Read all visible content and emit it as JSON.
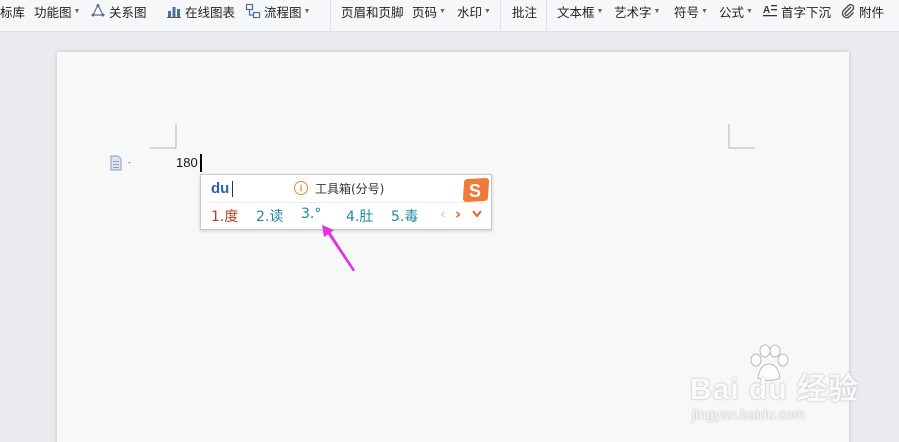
{
  "toolbar": {
    "items": [
      {
        "label": "标库",
        "caret": false,
        "icon": "none"
      },
      {
        "label": "功能图",
        "caret": true,
        "icon": "none"
      },
      {
        "label": "关系图",
        "caret": false,
        "icon": "relation-graph-icon"
      },
      {
        "label": "在线图表",
        "caret": false,
        "icon": "chart-icon"
      },
      {
        "label": "流程图",
        "caret": true,
        "icon": "flowchart-icon"
      },
      {
        "label": "页眉和页脚",
        "caret": false,
        "icon": "none"
      },
      {
        "label": "页码",
        "caret": true,
        "icon": "none"
      },
      {
        "label": "水印",
        "caret": true,
        "icon": "none"
      },
      {
        "label": "批注",
        "caret": false,
        "icon": "none"
      },
      {
        "label": "文本框",
        "caret": true,
        "icon": "none"
      },
      {
        "label": "艺术字",
        "caret": true,
        "icon": "none"
      },
      {
        "label": "符号",
        "caret": true,
        "icon": "none"
      },
      {
        "label": "公式",
        "caret": true,
        "icon": "none"
      },
      {
        "label": "首字下沉",
        "caret": false,
        "icon": "drop-cap-icon"
      },
      {
        "label": "附件",
        "caret": false,
        "icon": "paperclip-icon"
      }
    ]
  },
  "document": {
    "text": "180"
  },
  "ime": {
    "input": "du",
    "toolbox_label": "工具箱(分号)",
    "info_glyph": "i",
    "candidates": [
      "1.度",
      "2.读",
      "3.°",
      "4.肚",
      "5.毒"
    ],
    "prev_glyph": "‹",
    "next_glyph": "›",
    "expand_glyph": "⌄"
  },
  "watermark": {
    "brand": "Bai du 经验",
    "url": "jingyan.baidu.com"
  },
  "colors": {
    "toolbar_bg": "#f6f7f9",
    "page_bg": "#f7f8f8",
    "ime_input": "#2f5fb4",
    "candidate": "#1e8a9e",
    "candidate_first": "#c0392b",
    "arrow": "#e236d8",
    "ime_logo": "#f07a3a"
  }
}
